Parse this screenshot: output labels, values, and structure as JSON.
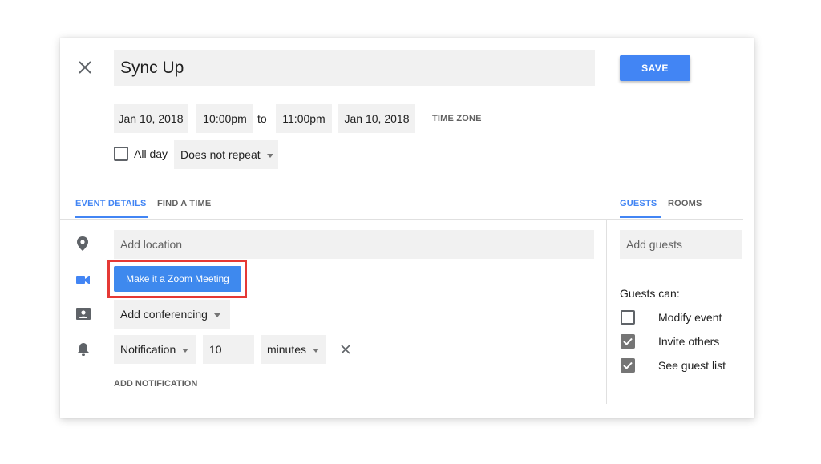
{
  "title": "Sync Up",
  "save_label": "SAVE",
  "start_date": "Jan 10, 2018",
  "start_time": "10:00pm",
  "to_label": "to",
  "end_time": "11:00pm",
  "end_date": "Jan 10, 2018",
  "time_zone_label": "TIME ZONE",
  "all_day_label": "All day",
  "repeat_value": "Does not repeat",
  "tabs": {
    "event_details": "EVENT DETAILS",
    "find_a_time": "FIND A TIME",
    "guests": "GUESTS",
    "rooms": "ROOMS"
  },
  "location_placeholder": "Add location",
  "zoom_button_label": "Make it a Zoom Meeting",
  "conferencing_label": "Add conferencing",
  "notification": {
    "type": "Notification",
    "amount": "10",
    "unit": "minutes"
  },
  "add_notification_label": "ADD NOTIFICATION",
  "guests_placeholder": "Add guests",
  "guests_can_label": "Guests can:",
  "permissions": [
    {
      "label": "Modify event",
      "checked": false
    },
    {
      "label": "Invite others",
      "checked": true
    },
    {
      "label": "See guest list",
      "checked": true
    }
  ],
  "colors": {
    "accent": "#4285f4",
    "zoom_button": "#3e89ee",
    "highlight_border": "#e53935"
  }
}
